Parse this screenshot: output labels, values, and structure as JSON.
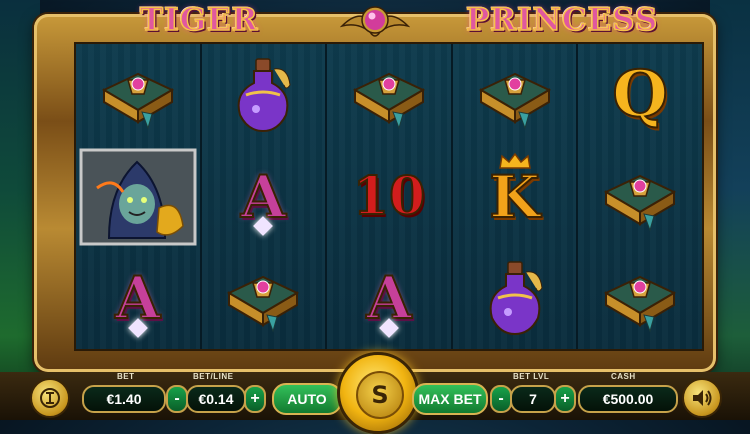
{
  "game": {
    "title_left": "TIGER",
    "title_right": "PRINCESS"
  },
  "reels": [
    [
      "spellbook",
      "tiger-warrior",
      "A"
    ],
    [
      "potion",
      "A",
      "spellbook"
    ],
    [
      "spellbook",
      "10",
      "A"
    ],
    [
      "spellbook",
      "K",
      "potion"
    ],
    [
      "Q",
      "spellbook",
      "spellbook"
    ]
  ],
  "controls": {
    "bet_label": "BET",
    "bet_value": "€1.40",
    "betline_label": "BET/LINE",
    "betline_value": "€0.14",
    "minus": "-",
    "plus": "+",
    "auto_label": "AUTO",
    "spin_label": "S",
    "maxbet_label": "MAX BET",
    "betlvl_label": "BET LVL",
    "betlvl_value": "7",
    "cash_label": "CASH",
    "cash_value": "€500.00"
  },
  "colors": {
    "title_pink": "#e0589f",
    "frame_gold": "#c99a3a",
    "button_green": "#2db354",
    "spin_gold": "#f1b411"
  },
  "icons": {
    "menu": "coin-menu-icon",
    "sound": "speaker-icon"
  }
}
